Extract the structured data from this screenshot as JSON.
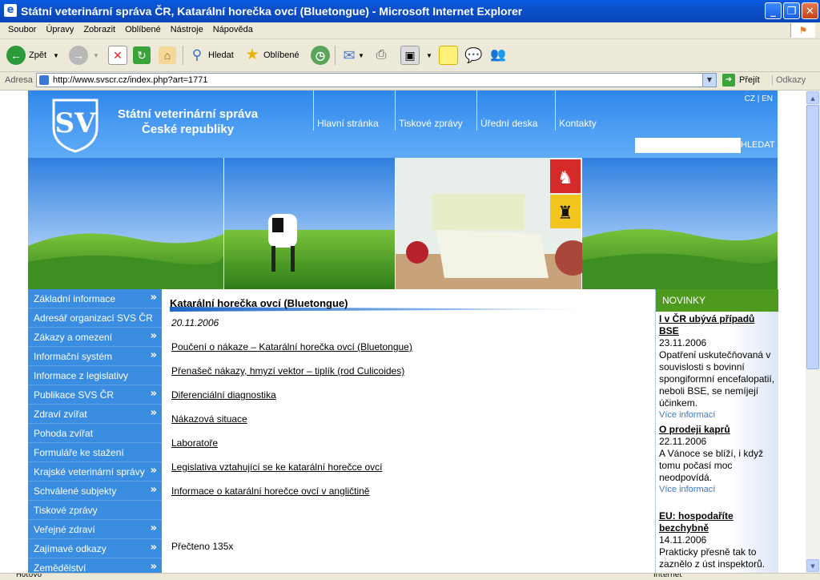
{
  "window": {
    "title": "Státní veterinární správa ČR, Katarální horečka ovcí (Bluetongue) - Microsoft Internet Explorer"
  },
  "menu": [
    "Soubor",
    "Úpravy",
    "Zobrazit",
    "Oblíbené",
    "Nástroje",
    "Nápověda"
  ],
  "toolbar": {
    "back": "Zpět",
    "search": "Hledat",
    "favorites": "Oblíbené"
  },
  "address": {
    "label": "Adresa",
    "url": "http://www.svscr.cz/index.php?art=1771",
    "go": "Přejít",
    "links": "Odkazy"
  },
  "site": {
    "name_line1": "Státní veterinární správa",
    "name_line2": "České republiky",
    "topnav": [
      "Hlavní stránka",
      "Tiskové zprávy",
      "Úřední deska",
      "Kontakty"
    ],
    "lang": "CZ | EN",
    "search_button": "HLEDAT"
  },
  "leftnav": [
    {
      "label": "Základní informace",
      "arrow": "»"
    },
    {
      "label": "Adresář organizací SVS ČR",
      "arrow": ""
    },
    {
      "label": "Zákazy a omezení",
      "arrow": "»"
    },
    {
      "label": "Informační systém",
      "arrow": "»"
    },
    {
      "label": "Informace z legislativy",
      "arrow": ""
    },
    {
      "label": "Publikace SVS ČR",
      "arrow": "»"
    },
    {
      "label": "Zdraví zvířat",
      "arrow": "»"
    },
    {
      "label": "Pohoda zvířat",
      "arrow": ""
    },
    {
      "label": "Formuláře ke stažení",
      "arrow": ""
    },
    {
      "label": "Krajské veterinární správy",
      "arrow": "»"
    },
    {
      "label": "Schválené subjekty",
      "arrow": "»"
    },
    {
      "label": "Tiskové zprávy",
      "arrow": ""
    },
    {
      "label": "Veřejné zdraví",
      "arrow": "»"
    },
    {
      "label": "Zajímavé odkazy",
      "arrow": "»"
    },
    {
      "label": "Zemědělství",
      "arrow": "»"
    }
  ],
  "article": {
    "title": "Katarální horečka ovcí (Bluetongue)",
    "date": "20.11.2006",
    "links": [
      "Poučení o nákaze – Katarální horečka ovcí  (Bluetongue)",
      "Přenašeč nákazy, hmyzí vektor – tiplík (rod Culicoides)",
      "Diferenciální diagnostika",
      "Nákazová situace",
      "Laboratoře",
      "Legislativa vztahující se ke katarální horečce ovcí",
      "Informace o katarální horečce ovcí v angličtině"
    ],
    "read_count": "Přečteno 135x"
  },
  "news": {
    "heading": "NOVINKY",
    "items": [
      {
        "title": "I v ČR ubývá případů BSE",
        "date": "23.11.2006",
        "text": "Opatřenί uskutečňovaná v souvislosti s bovinní spongiformní encefalopatií, neboli BSE, se nemíjejí účinkem.",
        "more": "Více informací"
      },
      {
        "title": "O prodeji kaprů",
        "date": "22.11.2006",
        "text": "A Vánoce se blíží, i když tomu počasí moc neodpovídá.",
        "more": "Více informací"
      },
      {
        "title": "EU: hospodaříte bezchybně",
        "date": "14.11.2006",
        "text": "Prakticky přesně tak to zaznělo z úst inspektorů.",
        "more": ""
      }
    ]
  },
  "status": {
    "left": "Hotovo",
    "right": "Internet"
  }
}
